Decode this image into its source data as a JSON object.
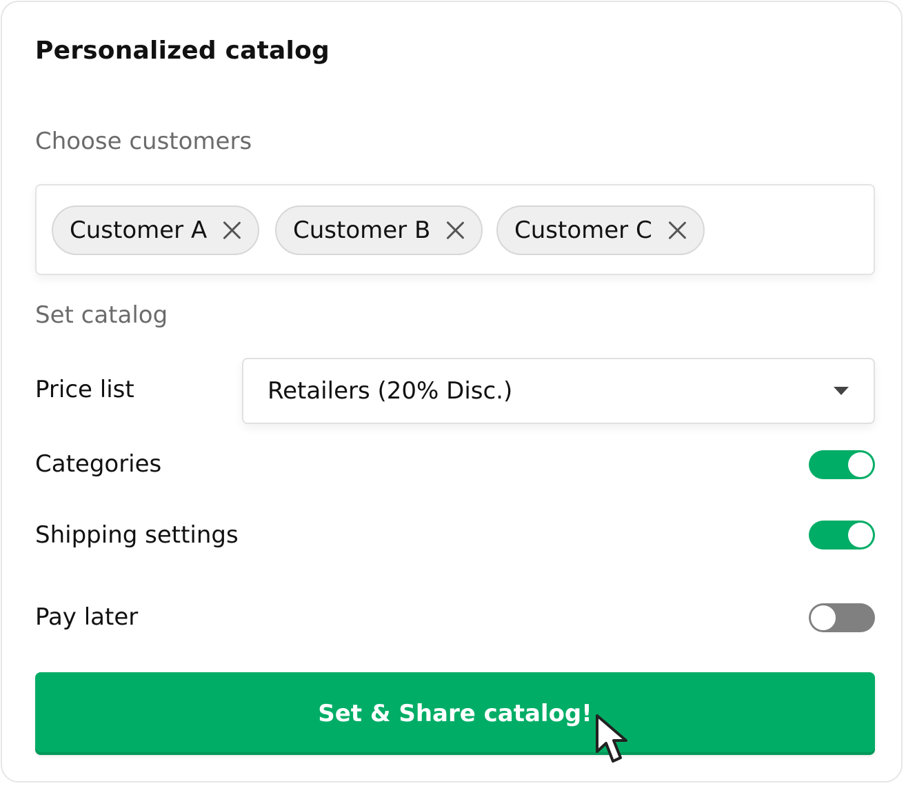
{
  "title": "Personalized catalog",
  "customers": {
    "label": "Choose customers",
    "chips": [
      {
        "label": "Customer A",
        "remove_icon": "close-icon"
      },
      {
        "label": "Customer B",
        "remove_icon": "close-icon"
      },
      {
        "label": "Customer C",
        "remove_icon": "close-icon"
      }
    ]
  },
  "catalog": {
    "label": "Set catalog",
    "price_list": {
      "label": "Price list",
      "value": "Retailers (20% Disc.)",
      "icon": "caret-down-icon"
    },
    "toggles": [
      {
        "label": "Categories",
        "on": true
      },
      {
        "label": "Shipping settings",
        "on": true
      },
      {
        "label": "Pay later",
        "on": false
      }
    ]
  },
  "cta": {
    "label": "Set & Share catalog!"
  },
  "colors": {
    "accent": "#00ad66",
    "toggle_off": "#808080",
    "border": "#e3e3e3",
    "label_muted": "#6b6b6b"
  }
}
